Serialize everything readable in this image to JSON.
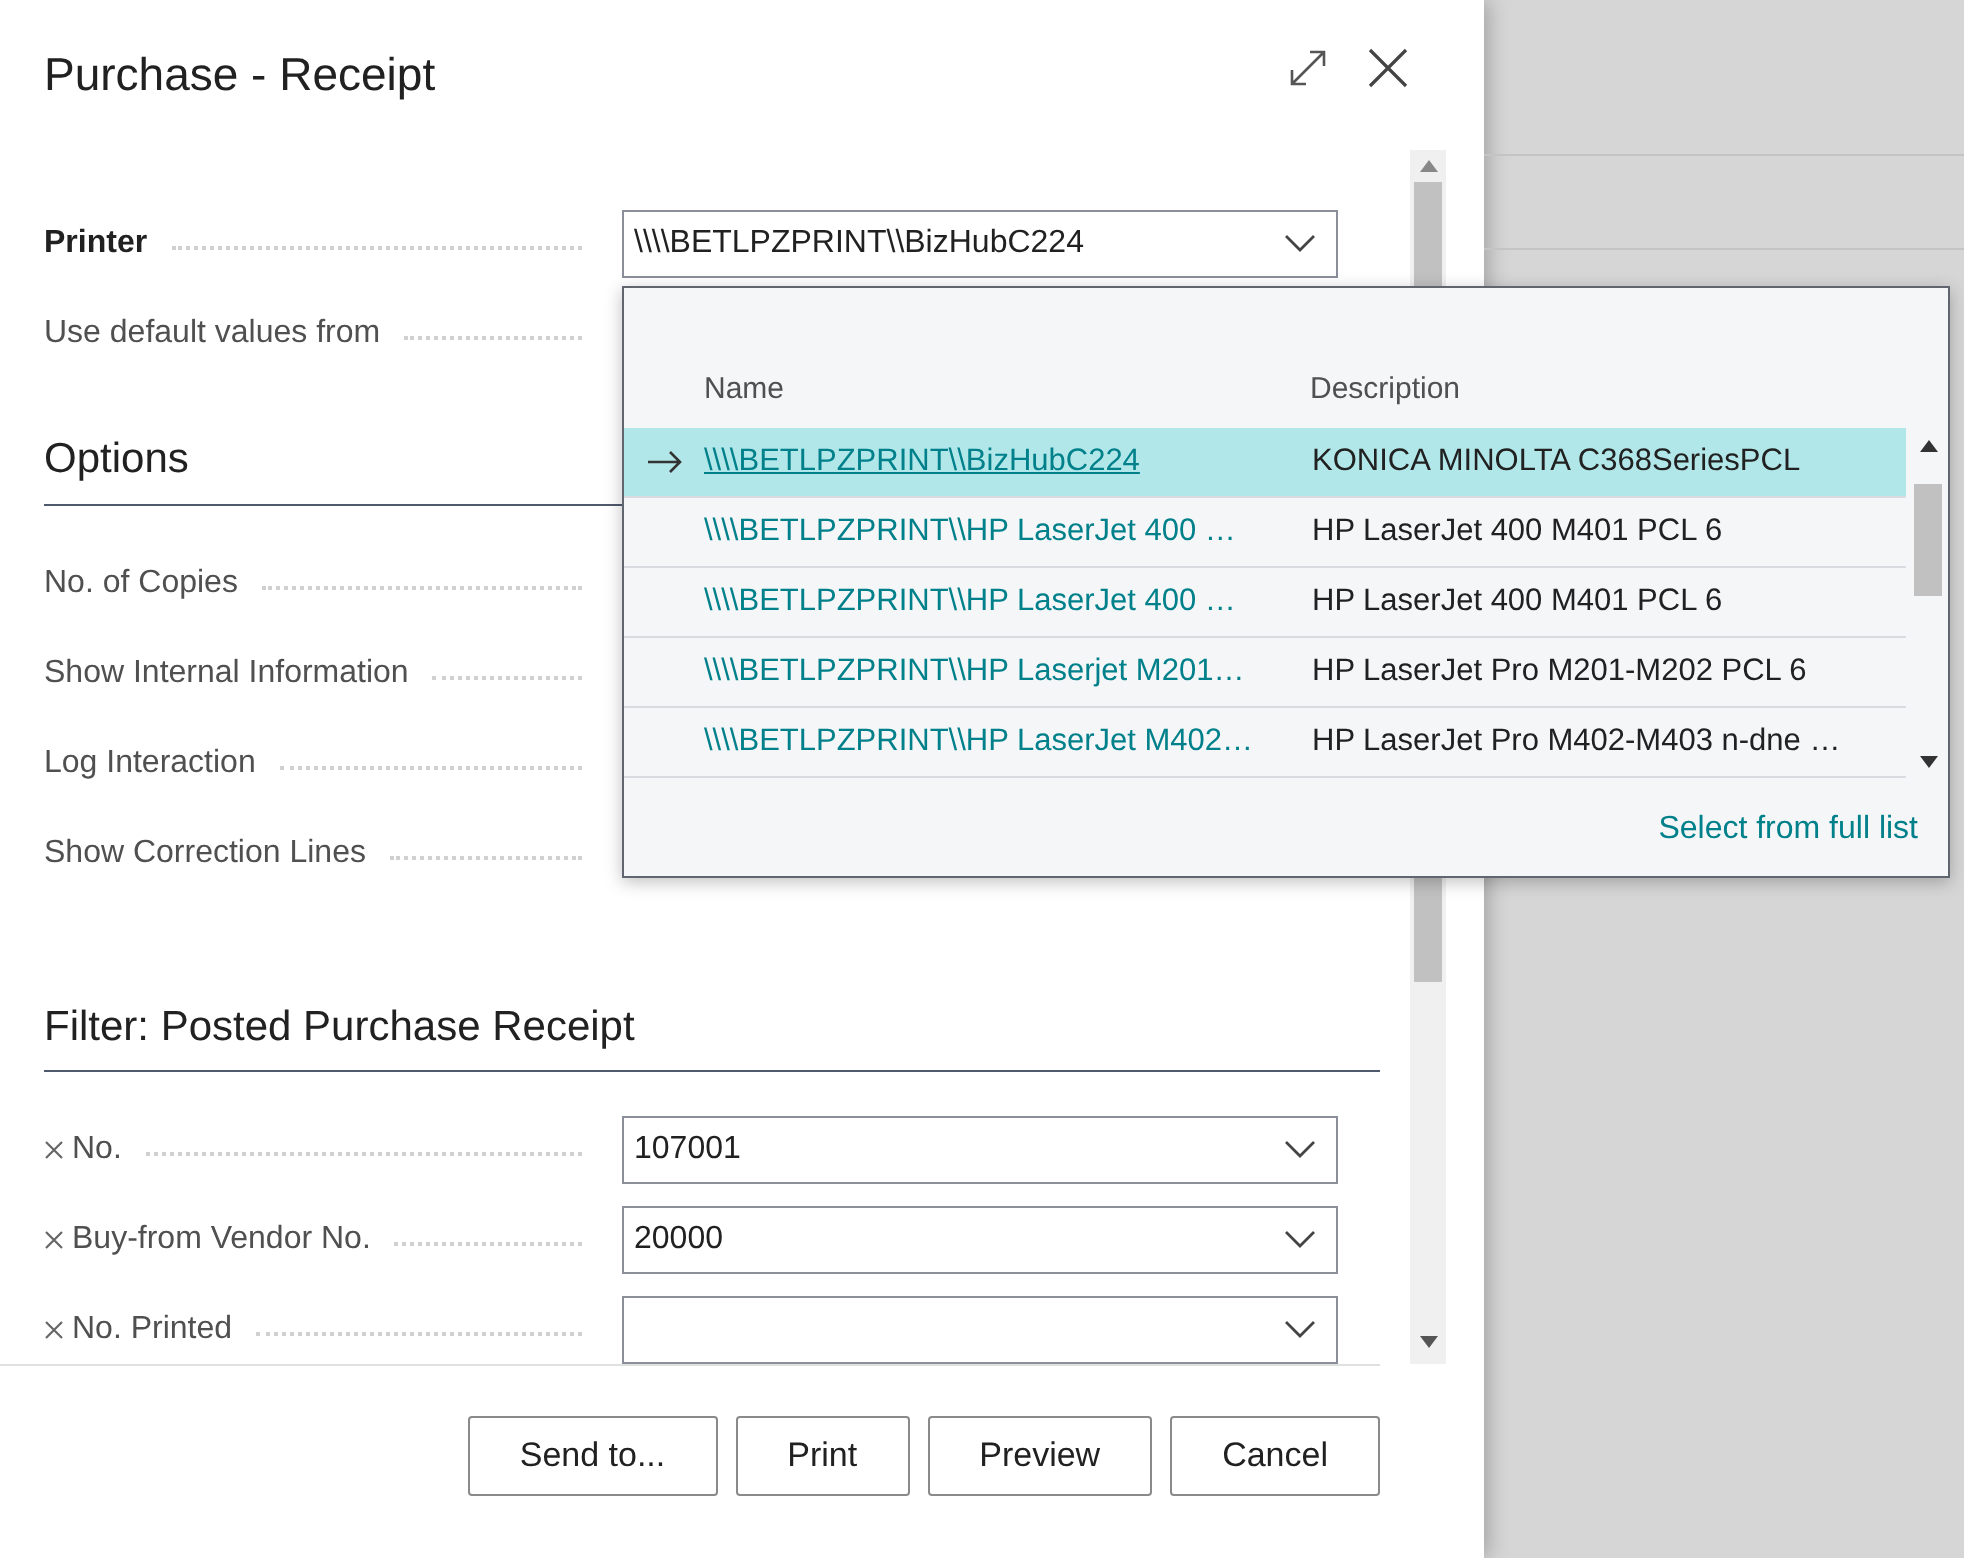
{
  "dialog": {
    "title": "Purchase - Receipt"
  },
  "general": [
    {
      "label": "Printer",
      "focused": true,
      "value": "\\\\\\\\BETLPZPRINT\\\\BizHubC224"
    },
    {
      "label": "Use default values from",
      "focused": false
    }
  ],
  "options": {
    "heading": "Options",
    "fields": [
      {
        "label": "No. of Copies"
      },
      {
        "label": "Show Internal Information"
      },
      {
        "label": "Log Interaction"
      },
      {
        "label": "Show Correction Lines"
      }
    ]
  },
  "filter": {
    "heading": "Filter: Posted Purchase Receipt",
    "fields": [
      {
        "label": "No.",
        "value": "107001"
      },
      {
        "label": "Buy-from Vendor No.",
        "value": "20000"
      },
      {
        "label": "No. Printed"
      }
    ]
  },
  "buttons": [
    "Send to...",
    "Print",
    "Preview",
    "Cancel"
  ],
  "printer_dropdown": {
    "columns": [
      "Name",
      "Description"
    ],
    "rows": [
      {
        "name": "\\\\\\\\BETLPZPRINT\\\\BizHubC224",
        "description": "KONICA MINOLTA C368SeriesPCL",
        "selected": true
      },
      {
        "name": "\\\\\\\\BETLPZPRINT\\\\HP LaserJet 400 …",
        "description": "HP LaserJet 400 M401 PCL 6",
        "selected": false
      },
      {
        "name": "\\\\\\\\BETLPZPRINT\\\\HP LaserJet 400 …",
        "description": "HP LaserJet 400 M401 PCL 6",
        "selected": false
      },
      {
        "name": "\\\\\\\\BETLPZPRINT\\\\HP Laserjet M201…",
        "description": "HP LaserJet Pro M201-M202 PCL 6",
        "selected": false
      },
      {
        "name": "\\\\\\\\BETLPZPRINT\\\\HP LaserJet M402…",
        "description": "HP LaserJet Pro M402-M403 n-dne …",
        "selected": false
      }
    ],
    "link": "Select from full list"
  }
}
